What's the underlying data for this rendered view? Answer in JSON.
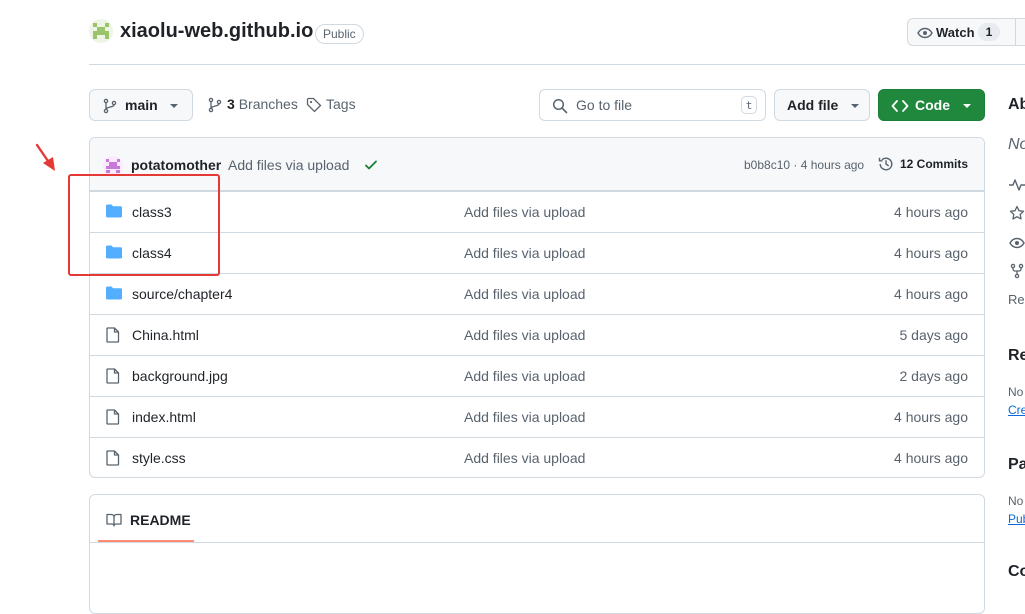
{
  "repo": {
    "name": "xiaolu-web.github.io",
    "visibility": "Public",
    "watch_label": "Watch",
    "watch_count": "1"
  },
  "toolbar": {
    "branch": "main",
    "branches_count": "3",
    "branches_label": "Branches",
    "tags_label": "Tags",
    "goto_placeholder": "Go to file",
    "goto_shortcut": "t",
    "add_file_label": "Add file",
    "code_label": "Code"
  },
  "latest_commit": {
    "author": "potatomother",
    "message": "Add files via upload",
    "hash_time": "b0b8c10 · 4 hours ago",
    "commits_label": "12 Commits"
  },
  "files": [
    {
      "type": "folder",
      "name": "class3",
      "message": "Add files via upload",
      "time": "4 hours ago"
    },
    {
      "type": "folder",
      "name": "class4",
      "message": "Add files via upload",
      "time": "4 hours ago"
    },
    {
      "type": "folder",
      "name": "source/chapter4",
      "message": "Add files via upload",
      "time": "4 hours ago"
    },
    {
      "type": "file",
      "name": "China.html",
      "message": "Add files via upload",
      "time": "5 days ago"
    },
    {
      "type": "file",
      "name": "background.jpg",
      "message": "Add files via upload",
      "time": "2 days ago"
    },
    {
      "type": "file",
      "name": "index.html",
      "message": "Add files via upload",
      "time": "4 hours ago"
    },
    {
      "type": "file",
      "name": "style.css",
      "message": "Add files via upload",
      "time": "4 hours ago"
    }
  ],
  "readme": {
    "tab_label": "README"
  },
  "sidebar": {
    "about_heading": "Ab",
    "no_description": "No",
    "readme_link": "Re",
    "releases_heading": "Re",
    "releases_text": "No",
    "releases_link": "Cre",
    "packages_heading": "Pa",
    "packages_text": "No",
    "packages_link": "Pub",
    "contributors_heading": "Co"
  },
  "colors": {
    "accent_green": "#1f883d",
    "folder_blue": "#54aeff",
    "annotation_red": "#e53935",
    "check_green": "#1a7f37"
  }
}
